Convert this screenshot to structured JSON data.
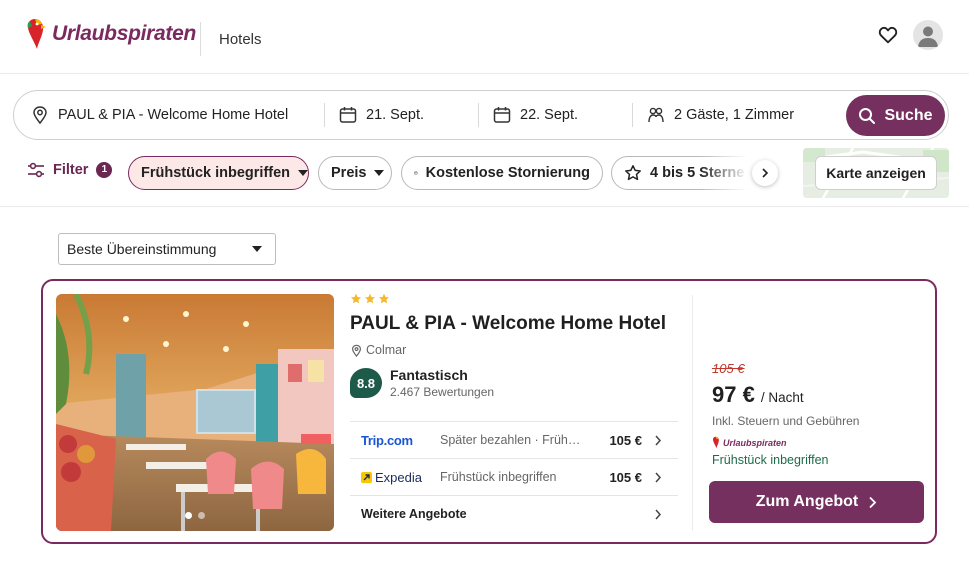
{
  "header": {
    "brand": "Urlaubspiraten",
    "nav_label": "Hotels"
  },
  "search": {
    "destination": "PAUL & PIA - Welcome Home Hotel",
    "checkin": "21. Sept.",
    "checkout": "22. Sept.",
    "guests": "2 Gäste, 1 Zimmer",
    "button_label": "Suche"
  },
  "filters": {
    "filter_label": "Filter",
    "filter_count": "1",
    "chips": [
      {
        "label": "Frühstück inbegriffen",
        "active": true
      },
      {
        "label": "Preis",
        "active": false
      },
      {
        "label": "Kostenlose Stornierung",
        "active": false
      },
      {
        "label": "4 bis 5 Sterne",
        "active": false
      }
    ],
    "map_button": "Karte anzeigen"
  },
  "sort": {
    "selected": "Beste Übereinstimmung"
  },
  "hotel": {
    "star_count": 3,
    "name": "PAUL & PIA - Welcome Home Hotel",
    "location": "Colmar",
    "score": "8.8",
    "rating_word": "Fantastisch",
    "review_count": "2.467 Bewertungen",
    "photo_count": 2,
    "active_photo": 1,
    "offers": [
      {
        "provider": "Trip.com",
        "description": "Später bezahlen · Frühstück inbegriffen",
        "price": "105 €"
      },
      {
        "provider": "Expedia",
        "description": "Frühstück inbegriffen",
        "price": "105 €"
      }
    ],
    "more_offers": "Weitere Angebote",
    "old_price": "105 €",
    "price": "97 €",
    "per_night": "/ Nacht",
    "tax_note": "Inkl. Steuern und Gebühren",
    "partner": "Urlaubspiraten",
    "included": "Frühstück inbegriffen",
    "cta": "Zum Angebot"
  },
  "colors": {
    "brand": "#76305f",
    "rating_green": "#1e5a4a",
    "star": "#f5b82e",
    "old_price": "#c0392b"
  }
}
